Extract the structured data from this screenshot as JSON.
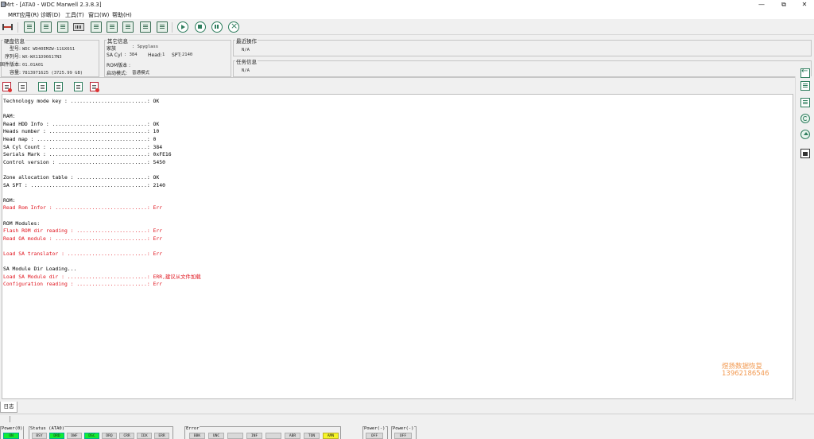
{
  "window": {
    "title": "Mrt - [ATA0 - WDC Marwell 2.3.8.3]",
    "controls": [
      "—",
      "⧉",
      "✕"
    ]
  },
  "menu": [
    {
      "label": "MRT应用(R)"
    },
    {
      "label": "诊断(D)"
    },
    {
      "label": "工具(T)"
    },
    {
      "label": "窗口(W)"
    },
    {
      "label": "帮助(H)"
    }
  ],
  "disk_info": {
    "title": "硬盘信息",
    "rows": [
      {
        "label": "型号:",
        "value": "WDC WD40EMZW-11GX6S1"
      },
      {
        "label": "序列号:",
        "value": "WX-WX11D96617N3"
      },
      {
        "label": "固件版本:",
        "value": "01.01A01"
      },
      {
        "label": "容量:",
        "value": "7813971625  (3725.99 GB)"
      }
    ]
  },
  "other_info": {
    "title": "其它信息",
    "family_label": "家族",
    "family_value": ": Spyglass",
    "sa_cyl_label": "SA Cyl",
    "sa_cyl_value": ": 384",
    "head_label": "Head:",
    "head_value": "1",
    "spt_label": "SPT:",
    "spt_value": "2140",
    "rom_label": "ROM版本 :",
    "mode_label": "启动模式:",
    "mode_value": "普通模式"
  },
  "recent_op": {
    "title": "最近操作",
    "value": "N/A"
  },
  "task_info": {
    "title": "任务信息",
    "value": "N/A"
  },
  "log_lines": [
    {
      "text": "Technology mode key : .........................: OK",
      "err": false
    },
    {
      "text": "",
      "err": false
    },
    {
      "text": "RAM:",
      "err": false
    },
    {
      "text": "Read HDD Info : ...............................: OK",
      "err": false
    },
    {
      "text": "Heads number : ................................: 10",
      "err": false
    },
    {
      "text": "Head map : ....................................: 0",
      "err": false
    },
    {
      "text": "SA Cyl Count : ................................: 384",
      "err": false
    },
    {
      "text": "Serials Mark : ................................: 0xFE16",
      "err": false
    },
    {
      "text": "Control version : .............................: 5450",
      "err": false
    },
    {
      "text": "",
      "err": false
    },
    {
      "text": "Zone allocation table : .......................: OK",
      "err": false
    },
    {
      "text": "SA SPT : ......................................: 2140",
      "err": false
    },
    {
      "text": "",
      "err": false
    },
    {
      "text": "ROM:",
      "err": false
    },
    {
      "text": "Read Rom Infor : ..............................: Err",
      "err": true
    },
    {
      "text": "",
      "err": false
    },
    {
      "text": "ROM Modules:",
      "err": false
    },
    {
      "text": "Flash ROM dir reading : .......................: Err",
      "err": true
    },
    {
      "text": "Read OA module : ..............................: Err",
      "err": true
    },
    {
      "text": "",
      "err": false
    },
    {
      "text": "Load SA translator : ..........................: Err",
      "err": true
    },
    {
      "text": "",
      "err": false
    },
    {
      "text": "SA Module Dir Loading...",
      "err": false
    },
    {
      "text": "Load SA Module dir : ..........................: ERR,建议从文件加载",
      "err": true
    },
    {
      "text": "Configuration reading : .......................: Err",
      "err": true
    }
  ],
  "watermark": {
    "line1": "煜扬数据恢复",
    "line2": "13962186546"
  },
  "log_tab_label": "日志",
  "status": {
    "power0": {
      "title": "Power(0)",
      "lamps": [
        "ON"
      ]
    },
    "ata0": {
      "title": "Status (ATA0)",
      "lamps": [
        "BSY",
        "DRD",
        "DWF",
        "DSC",
        "DRQ",
        "CRR",
        "IDX",
        "ERR"
      ]
    },
    "error": {
      "title": "Error",
      "lamps": [
        "BBK",
        "UNC",
        "",
        "INF",
        "",
        "ABR",
        "TON",
        "AMN"
      ]
    },
    "power1": {
      "title": "Power(-)",
      "lamps": [
        "OFF"
      ]
    },
    "power2": {
      "title": "Power(-)",
      "lamps": [
        "OFF"
      ]
    },
    "lit_color": "#11ee33",
    "warn_color": "#f5f528"
  }
}
